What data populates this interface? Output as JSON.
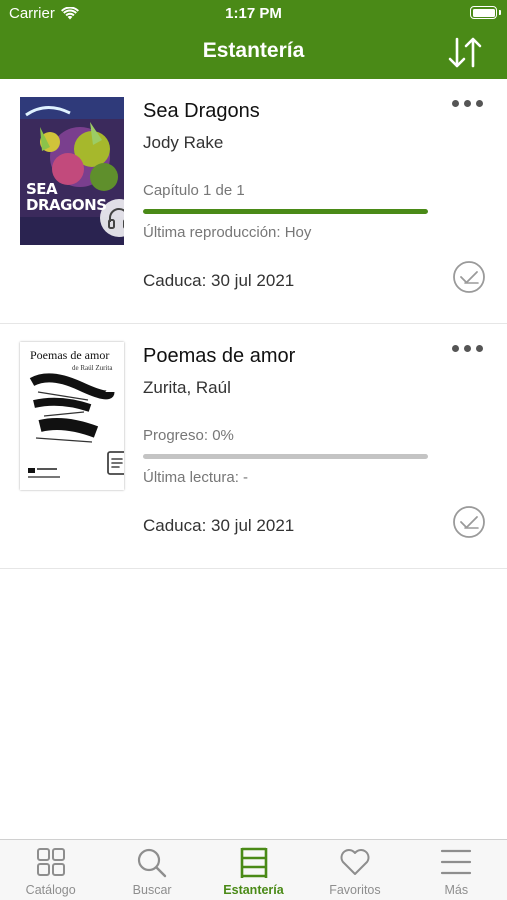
{
  "status_bar": {
    "carrier": "Carrier",
    "time": "1:17 PM"
  },
  "header": {
    "title": "Estantería",
    "sort_icon": "sort-arrows-icon"
  },
  "books": [
    {
      "title": "Sea Dragons",
      "author": "Jody Rake",
      "progress_text": "Capítulo 1 de 1",
      "progress": 1.0,
      "last_text": "Última reproducción: Hoy",
      "expires": "Caduca: 30 jul 2021",
      "cover_text": "SEA DRAGONS",
      "type_icon": "headphones-icon"
    },
    {
      "title": "Poemas de amor",
      "author": "Zurita, Raúl",
      "progress_text": "Progreso: 0%",
      "progress": 0.0,
      "last_text": "Última lectura: -",
      "expires": "Caduca: 30 jul 2021",
      "cover_title": "Poemas de amor",
      "cover_author": "de Raúl Zurita",
      "type_icon": "document-icon"
    }
  ],
  "tabs": [
    {
      "label": "Catálogo",
      "icon": "grid-icon",
      "active": false
    },
    {
      "label": "Buscar",
      "icon": "search-icon",
      "active": false
    },
    {
      "label": "Estantería",
      "icon": "shelf-icon",
      "active": true
    },
    {
      "label": "Favoritos",
      "icon": "heart-icon",
      "active": false
    },
    {
      "label": "Más",
      "icon": "menu-icon",
      "active": false
    }
  ],
  "colors": {
    "brand_green": "#4a8a17",
    "inactive_gray": "#8e8e8e"
  }
}
